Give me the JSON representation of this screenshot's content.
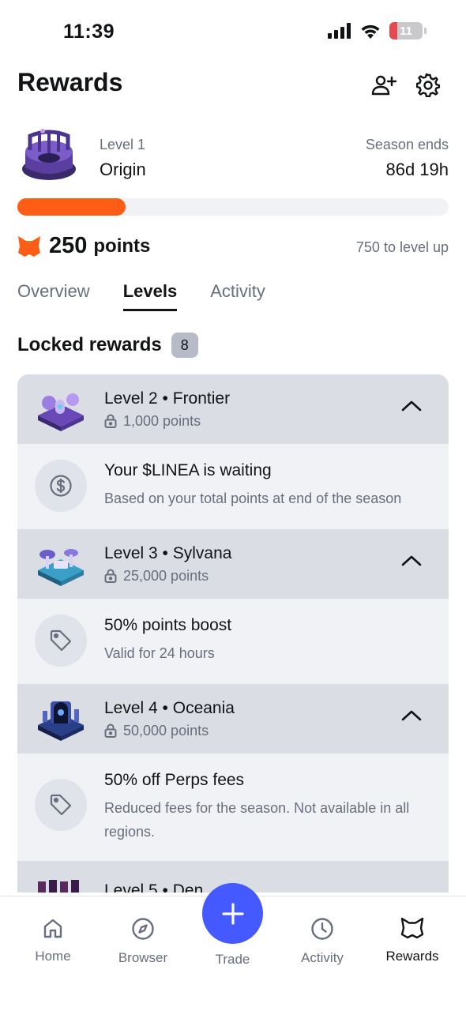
{
  "status_bar": {
    "time": "11:39",
    "battery": "11"
  },
  "header": {
    "title": "Rewards",
    "icons": [
      "add-user-icon",
      "gear-icon"
    ]
  },
  "level": {
    "label": "Level 1",
    "name": "Origin",
    "season_label": "Season ends",
    "season_value": "86d 19h",
    "progress_fraction": 0.25
  },
  "points": {
    "value": "250",
    "unit": "points",
    "to_level_up": "750 to level up",
    "accent": "#ff5c16"
  },
  "tabs": [
    {
      "label": "Overview",
      "active": false
    },
    {
      "label": "Levels",
      "active": true
    },
    {
      "label": "Activity",
      "active": false
    }
  ],
  "locked": {
    "title": "Locked rewards",
    "count": "8"
  },
  "levels": [
    {
      "title": "Level 2 • Frontier",
      "points": "1,000 points",
      "reward": {
        "icon": "dollar-coin-icon",
        "title": "Your $LINEA is waiting",
        "desc": "Based on your total points at end of the season"
      }
    },
    {
      "title": "Level 3 • Sylvana",
      "points": "25,000 points",
      "reward": {
        "icon": "tag-icon",
        "title": "50% points boost",
        "desc": "Valid for 24 hours"
      }
    },
    {
      "title": "Level 4 • Oceania",
      "points": "50,000 points",
      "reward": {
        "icon": "tag-icon",
        "title": "50% off Perps fees",
        "desc": "Reduced fees for the season. Not available in all regions."
      }
    }
  ],
  "partial_level": {
    "title": "Level 5 • Den"
  },
  "nav": {
    "home": "Home",
    "browser": "Browser",
    "trade": "Trade",
    "activity": "Activity",
    "rewards": "Rewards",
    "fab_color": "#4459ff"
  }
}
